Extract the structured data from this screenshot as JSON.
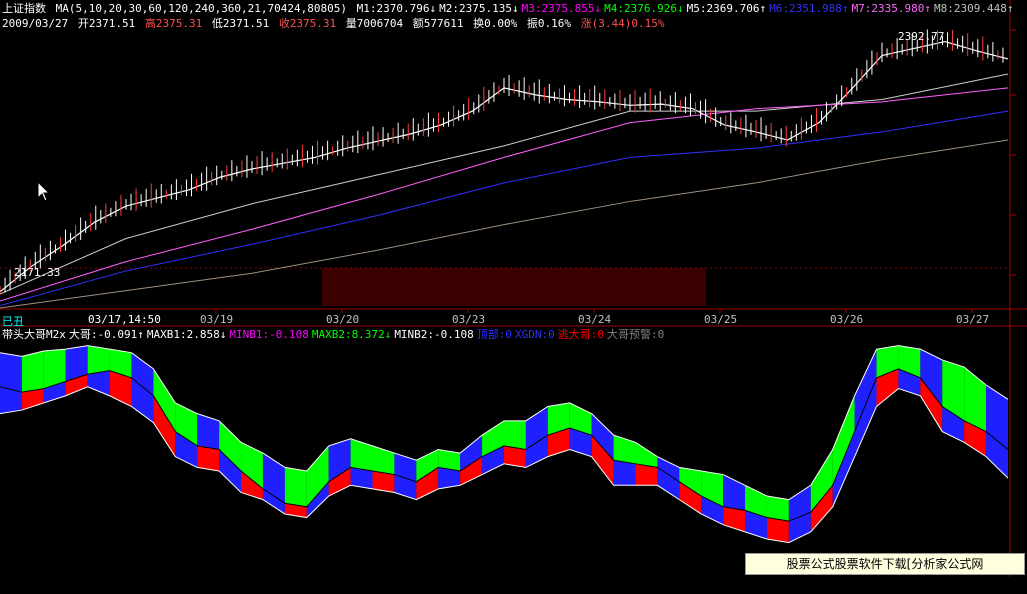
{
  "header": {
    "index_name": "上证指数",
    "ma_params": "MA(5,10,20,30,60,120,240,360,21,70424,80805)",
    "ma_values": [
      {
        "label": "M1:2370.796",
        "arrow": "↓",
        "color": "#ffffff"
      },
      {
        "label": "M2:2375.135",
        "arrow": "↓",
        "color": "#ffffff"
      },
      {
        "label": "M3:2375.855",
        "arrow": "↓",
        "color": "#ff00ff"
      },
      {
        "label": "M4:2376.926",
        "arrow": "↓",
        "color": "#00ff00"
      },
      {
        "label": "M5:2369.706",
        "arrow": "↑",
        "color": "#ffffff"
      },
      {
        "label": "M6:2351.988",
        "arrow": "↑",
        "color": "#3030ff"
      },
      {
        "label": "M7:2335.980",
        "arrow": "↑",
        "color": "#ff66ff"
      },
      {
        "label": "M8:2309.448",
        "arrow": "↑",
        "color": "#c0c0c0"
      }
    ],
    "quote": {
      "date": "2009/03/27",
      "open": "开2371.51",
      "high": "高2375.31",
      "low": "低2371.51",
      "close": "收2375.31",
      "volume": "量7006704",
      "amount": "额577611",
      "turnover": "换0.00%",
      "amplitude": "振0.16%",
      "change": "涨(3.44)0.15%"
    }
  },
  "chart_data": [
    {
      "type": "line",
      "title": "上证指数",
      "x_tick_labels": [
        "03/17,14:50",
        "03/19",
        "03/20",
        "03/23",
        "03/24",
        "03/25",
        "03/26",
        "03/27"
      ],
      "x_tick_positions": [
        0,
        1,
        2,
        3,
        4,
        5,
        6,
        7
      ],
      "annotations": [
        {
          "label": "2392.77",
          "kind": "high"
        },
        {
          "label": "2171.33",
          "kind": "low"
        }
      ],
      "ylim": [
        2160,
        2400
      ],
      "series": [
        {
          "x": [
            0,
            0.25,
            0.5,
            0.75,
            1.0,
            1.25,
            1.5,
            1.75,
            2.0,
            2.25,
            2.5,
            2.75,
            3.0,
            3.25,
            3.5,
            3.75,
            4.0,
            4.25,
            4.5,
            4.75,
            5.0,
            5.25,
            5.5,
            5.75,
            6.0,
            6.25,
            6.5,
            6.75,
            7.0,
            7.25,
            7.5,
            7.75,
            8.0
          ],
          "values": [
            2174,
            2196,
            2214,
            2234,
            2248,
            2255,
            2262,
            2273,
            2280,
            2285,
            2290,
            2298,
            2304,
            2310,
            2318,
            2330,
            2350,
            2344,
            2340,
            2338,
            2335,
            2336,
            2332,
            2318,
            2312,
            2305,
            2320,
            2348,
            2378,
            2384,
            2390,
            2382,
            2375
          ]
        },
        {
          "x": [
            0,
            1,
            2,
            3,
            4,
            5,
            6,
            7,
            8
          ],
          "values": [
            2172,
            2220,
            2250,
            2275,
            2300,
            2330,
            2330,
            2340,
            2362
          ]
        },
        {
          "x": [
            0,
            1,
            2,
            3,
            4,
            5,
            6,
            7,
            8
          ],
          "values": [
            2166,
            2200,
            2228,
            2258,
            2290,
            2320,
            2332,
            2338,
            2350
          ]
        },
        {
          "x": [
            0,
            1,
            2,
            3,
            4,
            5,
            6,
            7,
            8
          ],
          "values": [
            2162,
            2192,
            2215,
            2240,
            2268,
            2290,
            2298,
            2312,
            2330
          ]
        },
        {
          "x": [
            0,
            1,
            2,
            3,
            4,
            5,
            6,
            7,
            8
          ],
          "values": [
            2160,
            2175,
            2190,
            2210,
            2232,
            2252,
            2268,
            2288,
            2305
          ]
        }
      ]
    },
    {
      "type": "area",
      "title": "带头大哥M2x",
      "series": [
        {
          "name": "大哥",
          "values": [
            0.75,
            0.72,
            0.74,
            0.78,
            0.82,
            0.84,
            0.8,
            0.7,
            0.5,
            0.42,
            0.4,
            0.28,
            0.18,
            0.1,
            0.08,
            0.22,
            0.3,
            0.28,
            0.26,
            0.22,
            0.3,
            0.28,
            0.36,
            0.42,
            0.4,
            0.48,
            0.52,
            0.48,
            0.34,
            0.32,
            0.3,
            0.22,
            0.14,
            0.08,
            0.06,
            0.02,
            0.0,
            0.05,
            0.2,
            0.5,
            0.8,
            0.85,
            0.8,
            0.64,
            0.56,
            0.5,
            0.4
          ]
        },
        {
          "name": "MAXB2",
          "values": [
            0.94,
            0.92,
            0.95,
            0.96,
            0.98,
            0.96,
            0.94,
            0.85,
            0.66,
            0.6,
            0.56,
            0.44,
            0.38,
            0.3,
            0.28,
            0.42,
            0.46,
            0.42,
            0.38,
            0.34,
            0.4,
            0.38,
            0.48,
            0.56,
            0.56,
            0.64,
            0.66,
            0.6,
            0.48,
            0.44,
            0.36,
            0.3,
            0.28,
            0.26,
            0.2,
            0.14,
            0.12,
            0.2,
            0.4,
            0.7,
            0.96,
            0.98,
            0.96,
            0.9,
            0.86,
            0.76,
            0.68
          ]
        },
        {
          "name": "MINB2",
          "values": [
            0.6,
            0.62,
            0.66,
            0.7,
            0.75,
            0.7,
            0.64,
            0.55,
            0.36,
            0.3,
            0.28,
            0.16,
            0.12,
            0.04,
            0.02,
            0.14,
            0.2,
            0.18,
            0.16,
            0.12,
            0.18,
            0.2,
            0.26,
            0.32,
            0.3,
            0.36,
            0.4,
            0.36,
            0.2,
            0.2,
            0.2,
            0.12,
            0.04,
            -0.02,
            -0.06,
            -0.1,
            -0.12,
            -0.06,
            0.08,
            0.36,
            0.64,
            0.74,
            0.7,
            0.5,
            0.44,
            0.36,
            0.24
          ]
        }
      ],
      "legend": [
        {
          "label": "带头大哥M2x",
          "color": "#ffffff"
        },
        {
          "label": "大哥:-0.091↑",
          "color": "#ffffff"
        },
        {
          "label": "MAXB1:2.858↓",
          "color": "#ffffff"
        },
        {
          "label": "MINB1:-0.108",
          "color": "#ff00ff"
        },
        {
          "label": "MAXB2:8.372↓",
          "color": "#00ff00"
        },
        {
          "label": "MINB2:-0.108",
          "color": "#ffffff"
        },
        {
          "label": "顶部:0",
          "color": "#3030ff"
        },
        {
          "label": "XGDN:0",
          "color": "#3030ff"
        },
        {
          "label": "逃大哥:0",
          "color": "#ff0000"
        },
        {
          "label": "大哥预警:0",
          "color": "#808080"
        }
      ]
    }
  ],
  "footer": {
    "period_label": "已丑",
    "watermark": "股票公式股票软件下载[分析家公式网www.88gs.com]"
  },
  "colors": {
    "up": "#ff0000",
    "down": "#00ffff",
    "green": "#00ff00",
    "blue": "#2020ff",
    "red": "#ff0000",
    "white": "#ffffff",
    "magenta": "#ff00ff",
    "darkred": "#3a0000"
  }
}
